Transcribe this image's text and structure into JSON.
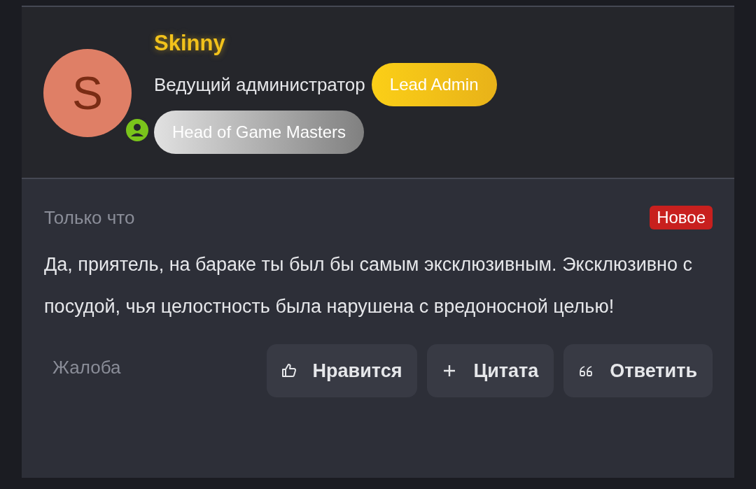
{
  "author": {
    "name": "Skinny",
    "avatar_letter": "S",
    "online": true,
    "title": "Ведущий администратор",
    "badges": [
      {
        "label": "Lead Admin",
        "kind": "gold"
      },
      {
        "label": "Head of Game Masters",
        "kind": "silver"
      }
    ]
  },
  "post": {
    "time": "Только что",
    "new_label": "Новое",
    "is_new": true,
    "text": "Да, приятель, на бараке ты был бы самым эксклюзивным. Эксклюзивно с посудой, чья целостность была нарушена с вредоносной целью!"
  },
  "report": "Жалоба",
  "actions": [
    {
      "label": "Нравится",
      "kind": "like"
    },
    {
      "label": "Цитата",
      "kind": "quote"
    },
    {
      "label": "Ответить",
      "kind": "reply"
    }
  ]
}
